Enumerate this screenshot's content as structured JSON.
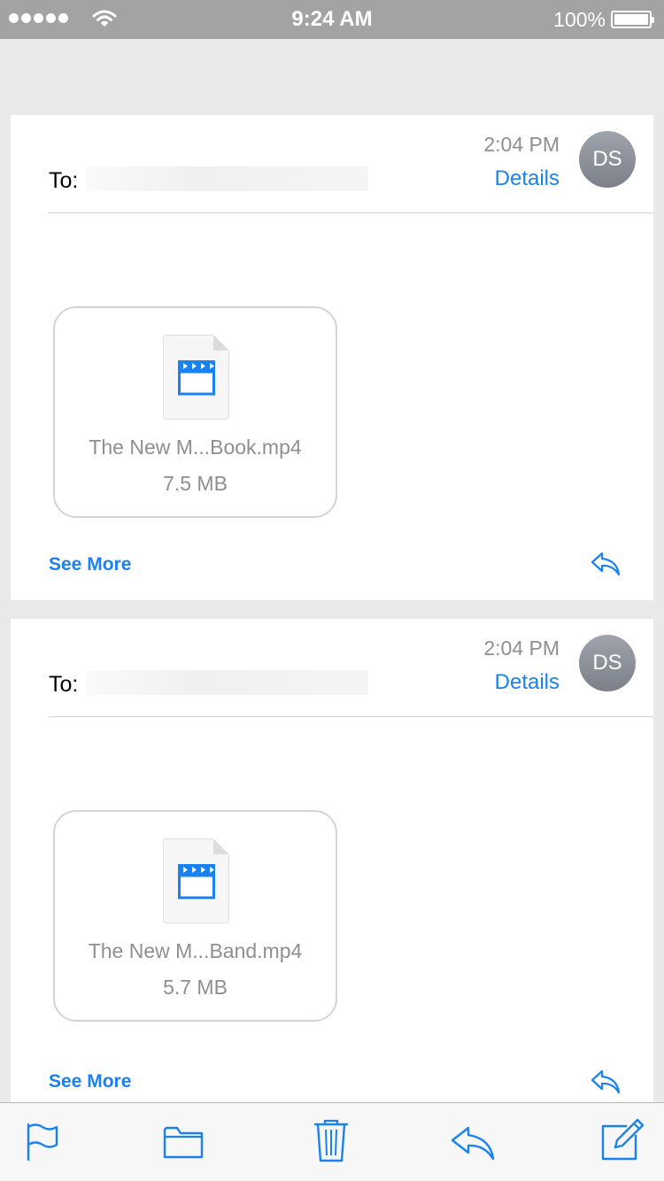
{
  "status_bar": {
    "time": "9:24 AM",
    "battery_percent": "100%",
    "battery_level": 1.0,
    "signal_bars": 5
  },
  "messages": [
    {
      "time": "2:04 PM",
      "details_label": "Details",
      "avatar_initials": "DS",
      "to_label": "To:",
      "attachment": {
        "name": "The New M...Book.mp4",
        "size": "7.5 MB",
        "icon": "video-file-icon"
      },
      "see_more_label": "See More"
    },
    {
      "time": "2:04 PM",
      "details_label": "Details",
      "avatar_initials": "DS",
      "to_label": "To:",
      "attachment": {
        "name": "The New M...Band.mp4",
        "size": "5.7 MB",
        "icon": "video-file-icon"
      },
      "see_more_label": "See More"
    }
  ],
  "toolbar": {
    "icons": [
      "flag-icon",
      "folder-icon",
      "trash-icon",
      "reply-icon",
      "compose-icon"
    ]
  },
  "colors": {
    "accent": "#1a82f0",
    "status_bar": "#a3a3a3",
    "secondary_text": "#8e8e93"
  }
}
